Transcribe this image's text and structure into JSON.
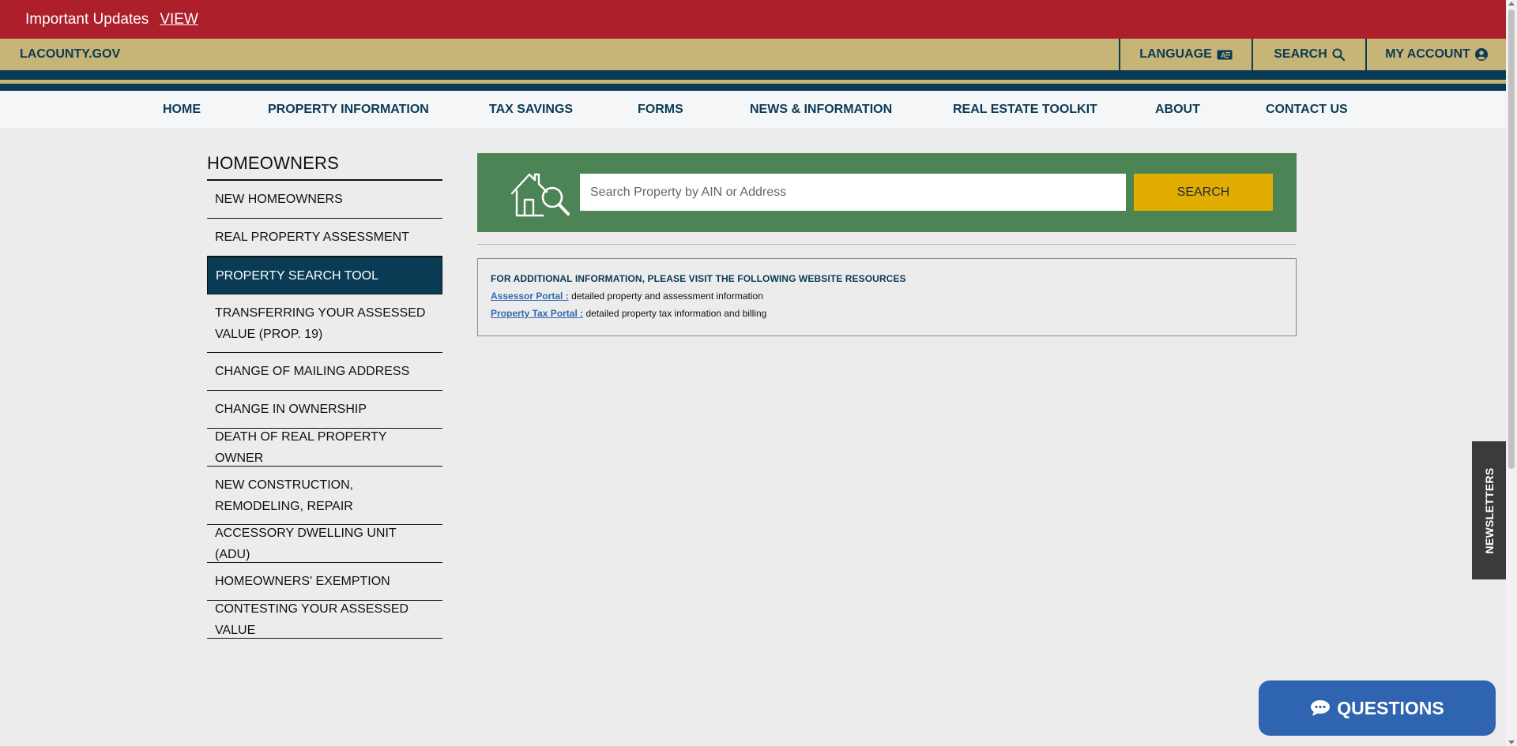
{
  "alert": {
    "text": "Important Updates",
    "link": "VIEW"
  },
  "county": {
    "site_link": "LACOUNTY.GOV",
    "language": "LANGUAGE",
    "search": "SEARCH",
    "account": "MY ACCOUNT"
  },
  "nav": {
    "items": [
      {
        "label": "HOME"
      },
      {
        "label": "PROPERTY INFORMATION"
      },
      {
        "label": "TAX SAVINGS"
      },
      {
        "label": "FORMS"
      },
      {
        "label": "NEWS & INFORMATION"
      },
      {
        "label": "REAL ESTATE TOOLKIT"
      },
      {
        "label": "ABOUT"
      },
      {
        "label": "CONTACT US"
      }
    ]
  },
  "sidebar": {
    "title": "HOMEOWNERS",
    "items": [
      {
        "label": "NEW HOMEOWNERS"
      },
      {
        "label": "REAL PROPERTY ASSESSMENT"
      },
      {
        "label": "PROPERTY SEARCH TOOL"
      },
      {
        "label": "TRANSFERRING YOUR ASSESSED VALUE (PROP. 19)"
      },
      {
        "label": "CHANGE OF MAILING ADDRESS"
      },
      {
        "label": "CHANGE IN OWNERSHIP"
      },
      {
        "label": "DEATH OF REAL PROPERTY OWNER"
      },
      {
        "label": "NEW CONSTRUCTION, REMODELING, REPAIR"
      },
      {
        "label": "ACCESSORY DWELLING UNIT (ADU)"
      },
      {
        "label": "HOMEOWNERS' EXEMPTION"
      },
      {
        "label": "CONTESTING YOUR ASSESSED VALUE"
      }
    ],
    "active_item": "PROPERTY SEARCH TOOL"
  },
  "search_panel": {
    "placeholder": "Search Property by AIN or Address",
    "value": "",
    "button": "SEARCH",
    "icon": "house-search-icon"
  },
  "info": {
    "heading": "FOR ADDITIONAL INFORMATION, PLEASE VISIT THE FOLLOWING WEBSITE RESOURCES",
    "links": [
      {
        "label": "Assessor Portal :",
        "description": "detailed property and assessment information"
      },
      {
        "label": "Property Tax Portal :",
        "description": "detailed property tax information and billing"
      }
    ]
  },
  "newsletter_tab": "NEWSLETTERS",
  "questions_button": "QUESTIONS",
  "colors": {
    "alert_red": "#ac1f2b",
    "gold": "#c7b577",
    "navy": "#0a3b55",
    "search_green": "#4d8455",
    "search_button": "#e0ad00",
    "questions_blue": "#2f64b1"
  },
  "icons": {
    "language": "language-card-icon",
    "search": "magnifier-icon",
    "account": "user-circle-icon",
    "questions": "chat-bubble-icon"
  }
}
